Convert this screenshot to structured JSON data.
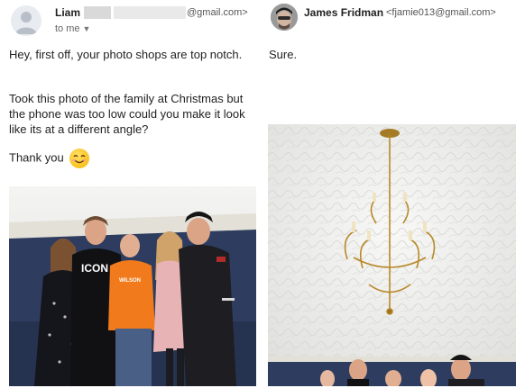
{
  "left_email": {
    "sender_name": "Liam",
    "sender_email_suffix": "@gmail.com>",
    "recipient_label": "to me",
    "paragraphs": [
      "Hey, first off, your photo shops are top notch.",
      "Took this photo of the family at Christmas but the phone was too low could you make it look like its at a different angle?",
      "Thank you"
    ],
    "emoji_icon": "smiling-face-icon",
    "shirt_texts": [
      "ICON",
      "WILSON"
    ]
  },
  "right_email": {
    "sender_name": "James Fridman",
    "sender_email": "<fjamie013@gmail.com>",
    "reply": "Sure."
  },
  "colors": {
    "text": "#222222",
    "muted": "#666666",
    "ceiling": "#eeeeee",
    "wall_blue": "#2e3d5f",
    "orange_shirt": "#f07a1c",
    "pink_dress": "#e8b3b5",
    "chandelier_gold": "#b8892a"
  }
}
